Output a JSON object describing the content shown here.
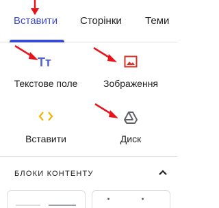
{
  "tabs": [
    {
      "label": "Вставити",
      "active": true
    },
    {
      "label": "Сторінки",
      "active": false
    },
    {
      "label": "Теми",
      "active": false
    }
  ],
  "tools": {
    "text_box": {
      "label": "Текстове поле",
      "icon": "text-box-icon",
      "icon_text": "Tт",
      "icon_color": "#4c5fd5"
    },
    "image": {
      "label": "Зображення",
      "icon": "image-icon",
      "icon_color": "#d93025"
    },
    "embed": {
      "label": "Вставити",
      "icon": "embed-code-icon",
      "icon_text": "<>",
      "icon_color": "#f4b400"
    },
    "drive": {
      "label": "Диск",
      "icon": "google-drive-icon",
      "icon_color": "#5f6368"
    }
  },
  "content_blocks": {
    "title": "БЛОКИ КОНТЕНТУ",
    "collapse_icon": "chevron-up-icon"
  },
  "colors": {
    "accent": "#3c4bcd",
    "annotation_arrow": "#e8131b"
  }
}
